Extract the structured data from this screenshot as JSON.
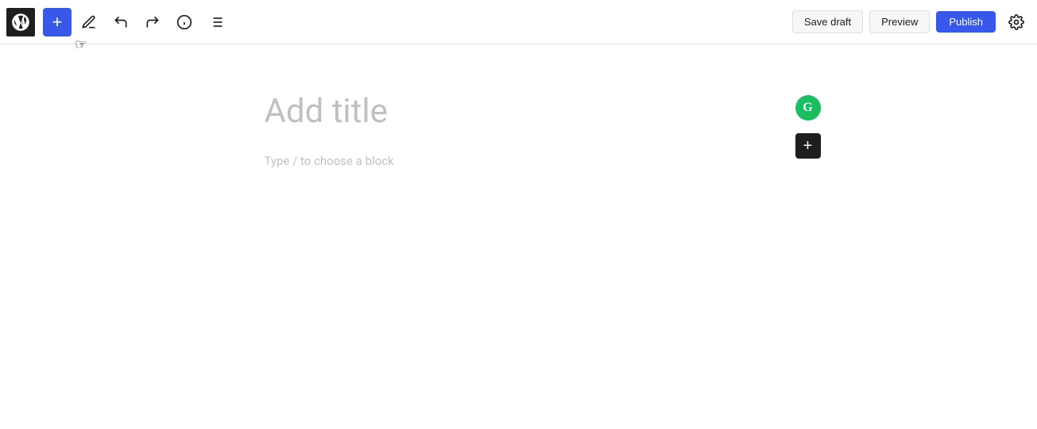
{
  "toolbar": {
    "wp_logo_label": "WordPress",
    "add_button_label": "+",
    "save_draft_label": "Save draft",
    "preview_label": "Preview",
    "publish_label": "Publish",
    "undo_label": "Undo",
    "redo_label": "Redo",
    "info_label": "Document info",
    "list_view_label": "List view",
    "settings_label": "Settings"
  },
  "editor": {
    "title_placeholder": "Add title",
    "block_placeholder": "Type / to choose a block"
  }
}
